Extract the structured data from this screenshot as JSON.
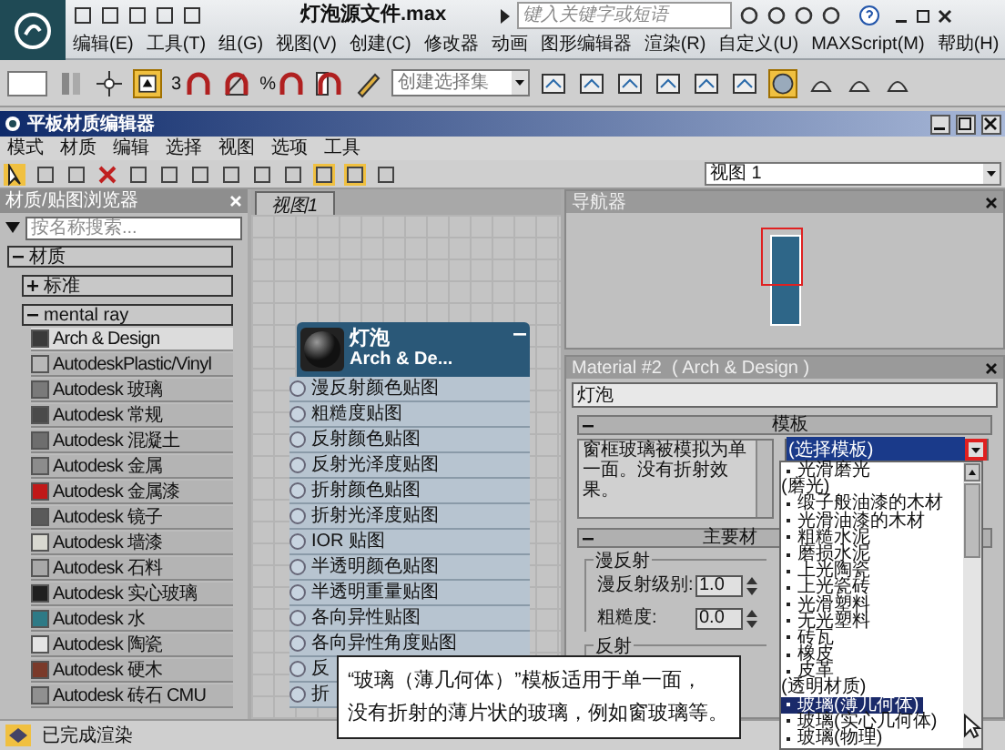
{
  "app": {
    "title": "灯泡源文件.max",
    "search": {
      "placeholder": "键入关键字或短语"
    },
    "menu": [
      "编辑(E)",
      "工具(T)",
      "组(G)",
      "视图(V)",
      "创建(C)",
      "修改器",
      "动画",
      "图形编辑器",
      "渲染(R)",
      "自定义(U)",
      "MAXScript(M)",
      "帮助(H)"
    ]
  },
  "toolbar": {
    "snap_labels": [
      "3",
      "%"
    ],
    "selection_set": {
      "placeholder": "创建选择集"
    }
  },
  "editor": {
    "title": "平板材质编辑器",
    "menu": [
      "模式",
      "材质",
      "编辑",
      "选择",
      "视图",
      "选项",
      "工具"
    ],
    "view_select": "视图 1"
  },
  "browser": {
    "title": "材质/贴图浏览器",
    "search": {
      "placeholder": "按名称搜索..."
    },
    "groups": [
      {
        "label": "材质",
        "expanded": true,
        "children": [
          {
            "label": "标准",
            "expanded": false
          },
          {
            "label": "mental ray",
            "expanded": true,
            "items": [
              {
                "label": "Arch & Design",
                "selected": true,
                "color": "#3a3a3a"
              },
              {
                "label": "AutodeskPlastic/Vinyl",
                "selected": false,
                "color": "#b8b8b8"
              },
              {
                "label": "Autodesk 玻璃",
                "selected": false,
                "color": "#7a7a7a"
              },
              {
                "label": "Autodesk 常规",
                "selected": false,
                "color": "#4a4a4a"
              },
              {
                "label": "Autodesk 混凝土",
                "selected": false,
                "color": "#6e6e6e"
              },
              {
                "label": "Autodesk 金属",
                "selected": false,
                "color": "#8c8c8c"
              },
              {
                "label": "Autodesk 金属漆",
                "selected": false,
                "color": "#c01818"
              },
              {
                "label": "Autodesk 镜子",
                "selected": false,
                "color": "#5a5a5a"
              },
              {
                "label": "Autodesk 墙漆",
                "selected": false,
                "color": "#d8d8d0"
              },
              {
                "label": "Autodesk 石料",
                "selected": false,
                "color": "#a8a8a8"
              },
              {
                "label": "Autodesk 实心玻璃",
                "selected": false,
                "color": "#202020"
              },
              {
                "label": "Autodesk 水",
                "selected": false,
                "color": "#2e7a86"
              },
              {
                "label": "Autodesk 陶瓷",
                "selected": false,
                "color": "#e4e4e4"
              },
              {
                "label": "Autodesk 硬木",
                "selected": false,
                "color": "#7a3a2a"
              },
              {
                "label": "Autodesk 砖石 CMU",
                "selected": false,
                "color": "#909090"
              }
            ]
          }
        ]
      }
    ]
  },
  "view": {
    "tab": "视图1",
    "node": {
      "name": "灯泡",
      "type": "Arch & De...",
      "slots": [
        "漫反射颜色贴图",
        "粗糙度贴图",
        "反射颜色贴图",
        "反射光泽度贴图",
        "折射颜色贴图",
        "折射光泽度贴图",
        "IOR 贴图",
        "半透明颜色贴图",
        "半透明重量贴图",
        "各向异性贴图",
        "各向异性角度贴图",
        "反",
        "折"
      ]
    }
  },
  "navigator": {
    "title": "导航器"
  },
  "material": {
    "title": "Material #2  ( Arch & Design )",
    "name": "灯泡",
    "template": {
      "title": "模板",
      "expanded": true,
      "description": "窗框玻璃被模拟为单一面。没有折射效果。",
      "dropdown": {
        "value": "(选择模板)",
        "open": true,
        "options": [
          {
            "label": "光滑磨光",
            "kind": "item",
            "selected": false
          },
          {
            "label": "(磨光)",
            "kind": "group",
            "selected": false
          },
          {
            "label": "缎子般油漆的木材",
            "kind": "item",
            "selected": false
          },
          {
            "label": "光滑油漆的木材",
            "kind": "item",
            "selected": false
          },
          {
            "label": "粗糙水泥",
            "kind": "item",
            "selected": false
          },
          {
            "label": "磨损水泥",
            "kind": "item",
            "selected": false
          },
          {
            "label": "上光陶瓷",
            "kind": "item",
            "selected": false
          },
          {
            "label": "上光瓷砖",
            "kind": "item",
            "selected": false
          },
          {
            "label": "光滑塑料",
            "kind": "item",
            "selected": false
          },
          {
            "label": "无光塑料",
            "kind": "item",
            "selected": false
          },
          {
            "label": "砖瓦",
            "kind": "item",
            "selected": false
          },
          {
            "label": "橡皮",
            "kind": "item",
            "selected": false
          },
          {
            "label": "皮革",
            "kind": "item",
            "selected": false
          },
          {
            "label": "(透明材质)",
            "kind": "group",
            "selected": false
          },
          {
            "label": "玻璃(薄几何体)",
            "kind": "item",
            "selected": true
          },
          {
            "label": "玻璃(实心几何体)",
            "kind": "item",
            "selected": false
          },
          {
            "label": "玻璃(物理)",
            "kind": "item",
            "selected": false
          }
        ]
      }
    },
    "main": {
      "title": "主要材",
      "expanded": true,
      "group": "漫反射",
      "fields": [
        {
          "label": "漫反射级别:",
          "value": "1.0"
        },
        {
          "label": "粗糙度:",
          "value": "0.0"
        }
      ],
      "next_group": "反射"
    }
  },
  "status_bar": {
    "text": "已完成渲染"
  },
  "note": {
    "lines": [
      "“玻璃（薄几何体）”模板适用于单一面，",
      "没有折射的薄片状的玻璃，例如窗玻璃等。"
    ]
  }
}
